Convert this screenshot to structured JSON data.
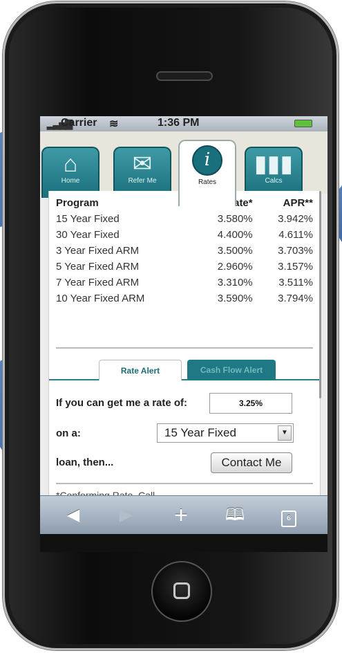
{
  "status_bar": {
    "carrier": "Carrier",
    "time": "1:36 PM"
  },
  "tabs": [
    {
      "label": "Home",
      "icon": "house-icon"
    },
    {
      "label": "Refer Me",
      "icon": "envelope-icon"
    },
    {
      "label": "Rates",
      "icon": "info-icon"
    },
    {
      "label": "Calcs",
      "icon": "bar-chart-icon"
    }
  ],
  "rates": {
    "headers": {
      "program": "Program",
      "rate": "Rate*",
      "apr": "APR**"
    },
    "rows": [
      {
        "program": "15 Year Fixed",
        "rate": "3.580%",
        "apr": "3.942%"
      },
      {
        "program": "30 Year Fixed",
        "rate": "4.400%",
        "apr": "4.611%"
      },
      {
        "program": "3 Year Fixed ARM",
        "rate": "3.500%",
        "apr": "3.703%"
      },
      {
        "program": "5 Year Fixed ARM",
        "rate": "2.960%",
        "apr": "3.157%"
      },
      {
        "program": "7 Year Fixed ARM",
        "rate": "3.310%",
        "apr": "3.511%"
      },
      {
        "program": "10 Year Fixed ARM",
        "rate": "3.590%",
        "apr": "3.794%"
      }
    ]
  },
  "alert_tabs": {
    "rate_alert": "Rate Alert",
    "cash_flow_alert": "Cash Flow Alert"
  },
  "form": {
    "rate_label": "If you can get me a rate of:",
    "rate_value": "3.25%",
    "loan_label": "on a:",
    "loan_selected": "15 Year Fixed",
    "then_label": "loan, then...",
    "contact_button": "Contact Me"
  },
  "footnote": "*Conforming Rate. Call",
  "toolbar": {
    "pages_count": "6"
  },
  "colors": {
    "teal": "#1a6f7c",
    "arrow_blue": "#4a76b8"
  }
}
